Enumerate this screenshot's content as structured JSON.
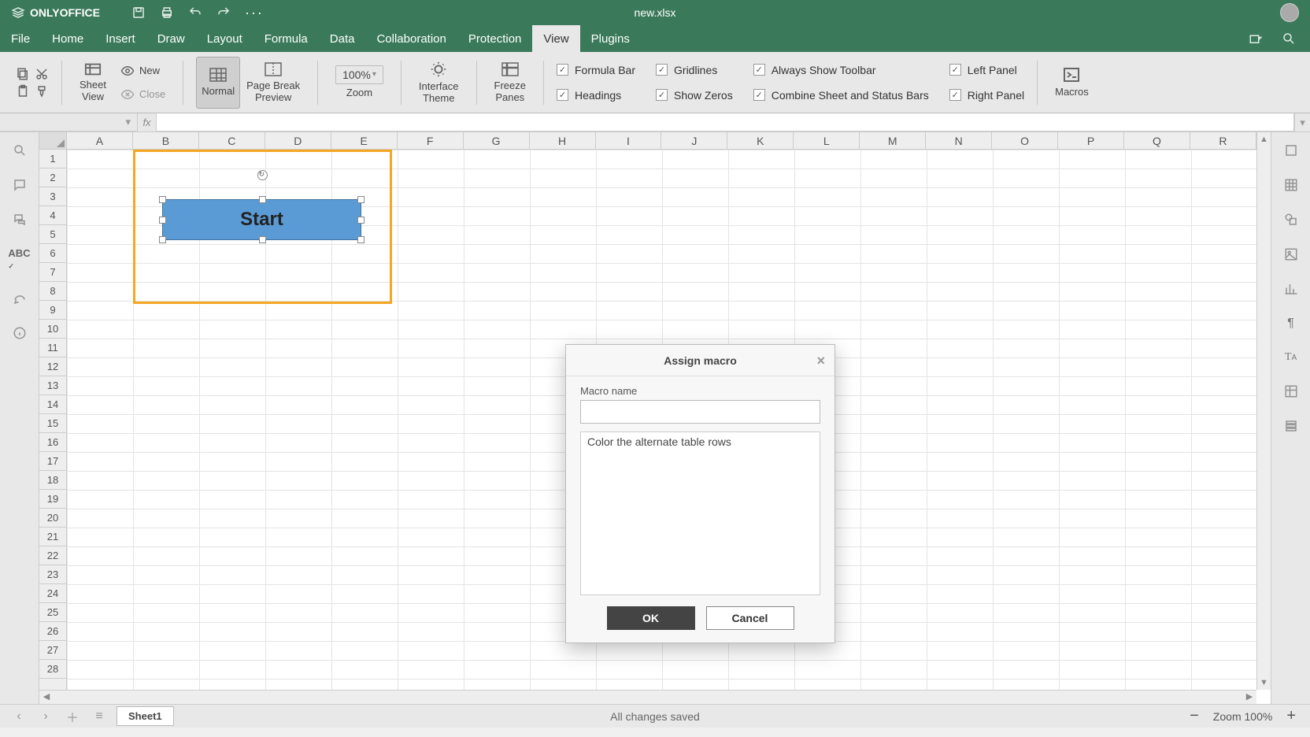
{
  "app": {
    "brand": "ONLYOFFICE",
    "doc_name": "new.xlsx"
  },
  "menu": {
    "tabs": [
      "File",
      "Home",
      "Insert",
      "Draw",
      "Layout",
      "Formula",
      "Data",
      "Collaboration",
      "Protection",
      "View",
      "Plugins"
    ],
    "active_index": 9
  },
  "ribbon": {
    "new": "New",
    "close": "Close",
    "sheet_view": "Sheet\nView",
    "normal": "Normal",
    "page_break": "Page Break\nPreview",
    "zoom_value": "100%",
    "zoom_label": "Zoom",
    "interface_theme": "Interface\nTheme",
    "freeze_panes": "Freeze\nPanes",
    "macros": "Macros",
    "checks": {
      "formula_bar": "Formula Bar",
      "headings": "Headings",
      "gridlines": "Gridlines",
      "show_zeros": "Show Zeros",
      "always_toolbar": "Always Show Toolbar",
      "combine_bars": "Combine Sheet and Status Bars",
      "left_panel": "Left Panel",
      "right_panel": "Right Panel"
    }
  },
  "formula_bar": {
    "fx": "fx"
  },
  "grid": {
    "columns": [
      "A",
      "B",
      "C",
      "D",
      "E",
      "F",
      "G",
      "H",
      "I",
      "J",
      "K",
      "L",
      "M",
      "N",
      "O",
      "P",
      "Q",
      "R"
    ],
    "rows": 28
  },
  "shape": {
    "text": "Start"
  },
  "dialog": {
    "title": "Assign macro",
    "label": "Macro name",
    "value": "",
    "list_item": "Color the alternate table rows",
    "ok": "OK",
    "cancel": "Cancel"
  },
  "status": {
    "sheet_name": "Sheet1",
    "message": "All changes saved",
    "zoom_label": "Zoom 100%"
  }
}
